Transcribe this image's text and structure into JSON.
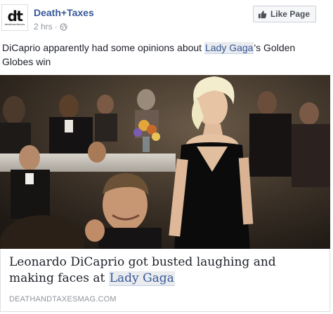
{
  "header": {
    "avatar_logo": "dt",
    "avatar_sub": "deathandtaxes",
    "page_name": "Death+Taxes",
    "timestamp": "2 hrs",
    "separator": "·",
    "privacy_icon": "globe-icon",
    "like_button_label": "Like Page",
    "like_icon": "thumbs-up-icon"
  },
  "post": {
    "text_before": "DiCaprio apparently had some opinions about ",
    "mention": "Lady Gaga",
    "text_after": "'s Golden Globes win"
  },
  "card": {
    "headline_before": "Leonardo DiCaprio got busted laughing and making faces at ",
    "headline_mention": "Lady Gaga",
    "domain": "DEATHANDTAXESMAG.COM"
  },
  "colors": {
    "link": "#365899",
    "meta": "#90949c",
    "mention_bg": "#e9ebee"
  }
}
